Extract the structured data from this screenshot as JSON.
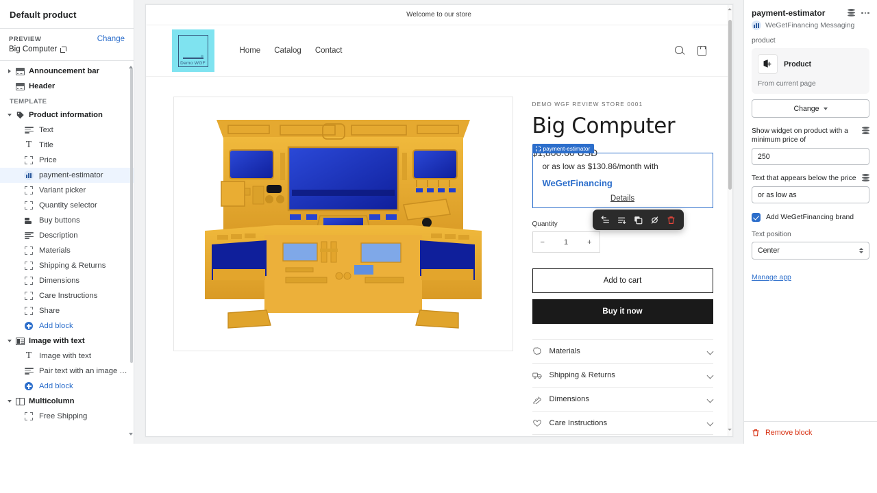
{
  "sidebar": {
    "title": "Default product",
    "preview_label": "PREVIEW",
    "change_link": "Change",
    "preview_name": "Big Computer",
    "top_items": [
      {
        "label": "Announcement bar",
        "icon": "section-icon",
        "caret": "right"
      },
      {
        "label": "Header",
        "icon": "section-icon",
        "caret": "none"
      }
    ],
    "template_label": "TEMPLATE",
    "groups": [
      {
        "label": "Product information",
        "icon": "tag-icon",
        "children": [
          {
            "label": "Text",
            "icon": "text-icon"
          },
          {
            "label": "Title",
            "icon": "title-icon"
          },
          {
            "label": "Price",
            "icon": "placeholder-icon"
          },
          {
            "label": "payment-estimator",
            "icon": "estimator-icon",
            "selected": true
          },
          {
            "label": "Variant picker",
            "icon": "placeholder-icon"
          },
          {
            "label": "Quantity selector",
            "icon": "placeholder-icon"
          },
          {
            "label": "Buy buttons",
            "icon": "buy-icon"
          },
          {
            "label": "Description",
            "icon": "text-icon"
          },
          {
            "label": "Materials",
            "icon": "placeholder-icon"
          },
          {
            "label": "Shipping & Returns",
            "icon": "placeholder-icon"
          },
          {
            "label": "Dimensions",
            "icon": "placeholder-icon"
          },
          {
            "label": "Care Instructions",
            "icon": "placeholder-icon"
          },
          {
            "label": "Share",
            "icon": "placeholder-icon"
          },
          {
            "label": "Add block",
            "icon": "add-icon",
            "is_add": true
          }
        ]
      },
      {
        "label": "Image with text",
        "icon": "image-text-icon",
        "children": [
          {
            "label": "Image with text",
            "icon": "title-icon"
          },
          {
            "label": "Pair text with an image to f...",
            "icon": "text-icon"
          },
          {
            "label": "Add block",
            "icon": "add-icon",
            "is_add": true
          }
        ]
      },
      {
        "label": "Multicolumn",
        "icon": "multicolumn-icon",
        "children": [
          {
            "label": "Free Shipping",
            "icon": "placeholder-icon"
          }
        ]
      }
    ]
  },
  "preview": {
    "announcement": "Welcome to our store",
    "logo_text": "Demo WGF",
    "nav": [
      "Home",
      "Catalog",
      "Contact"
    ],
    "product": {
      "vendor": "DEMO WGF REVIEW STORE 0001",
      "title": "Big Computer",
      "price": "$1,800.00 USD",
      "estimator_badge": "payment-estimator",
      "estimator_line1": "or as low as $130.86/month with",
      "estimator_brand": "WeGetFinancing",
      "estimator_details": "Details",
      "quantity_label": "Quantity",
      "quantity_value": "1",
      "minus": "−",
      "plus": "+",
      "add_to_cart": "Add to cart",
      "buy_now": "Buy it now",
      "accordions": [
        {
          "label": "Materials",
          "icon": "materials-icon"
        },
        {
          "label": "Shipping & Returns",
          "icon": "truck-icon"
        },
        {
          "label": "Dimensions",
          "icon": "ruler-icon"
        },
        {
          "label": "Care Instructions",
          "icon": "heart-icon"
        }
      ]
    },
    "toolbar": [
      {
        "name": "move-block-icon"
      },
      {
        "name": "reorder-block-icon"
      },
      {
        "name": "duplicate-icon"
      },
      {
        "name": "hide-icon"
      },
      {
        "name": "delete-icon"
      }
    ]
  },
  "settings": {
    "title": "payment-estimator",
    "app_name": "WeGetFinancing Messaging",
    "product_label": "product",
    "product_name": "Product",
    "product_source": "From current page",
    "change_button": "Change",
    "min_price_label": "Show widget on product with a minimum price of",
    "min_price_value": "250",
    "below_price_label": "Text that appears below the price",
    "below_price_value": "or as low as",
    "brand_checkbox_label": "Add WeGetFinancing brand",
    "brand_checked": true,
    "text_position_label": "Text position",
    "text_position_value": "Center",
    "manage_app": "Manage app",
    "remove_block": "Remove block"
  },
  "colors": {
    "accent": "#2c6ecb",
    "danger": "#d72c0d",
    "logo_bg": "#7fe3f0",
    "product_yellow": "#e8a92c",
    "product_blue": "#1430b8"
  }
}
